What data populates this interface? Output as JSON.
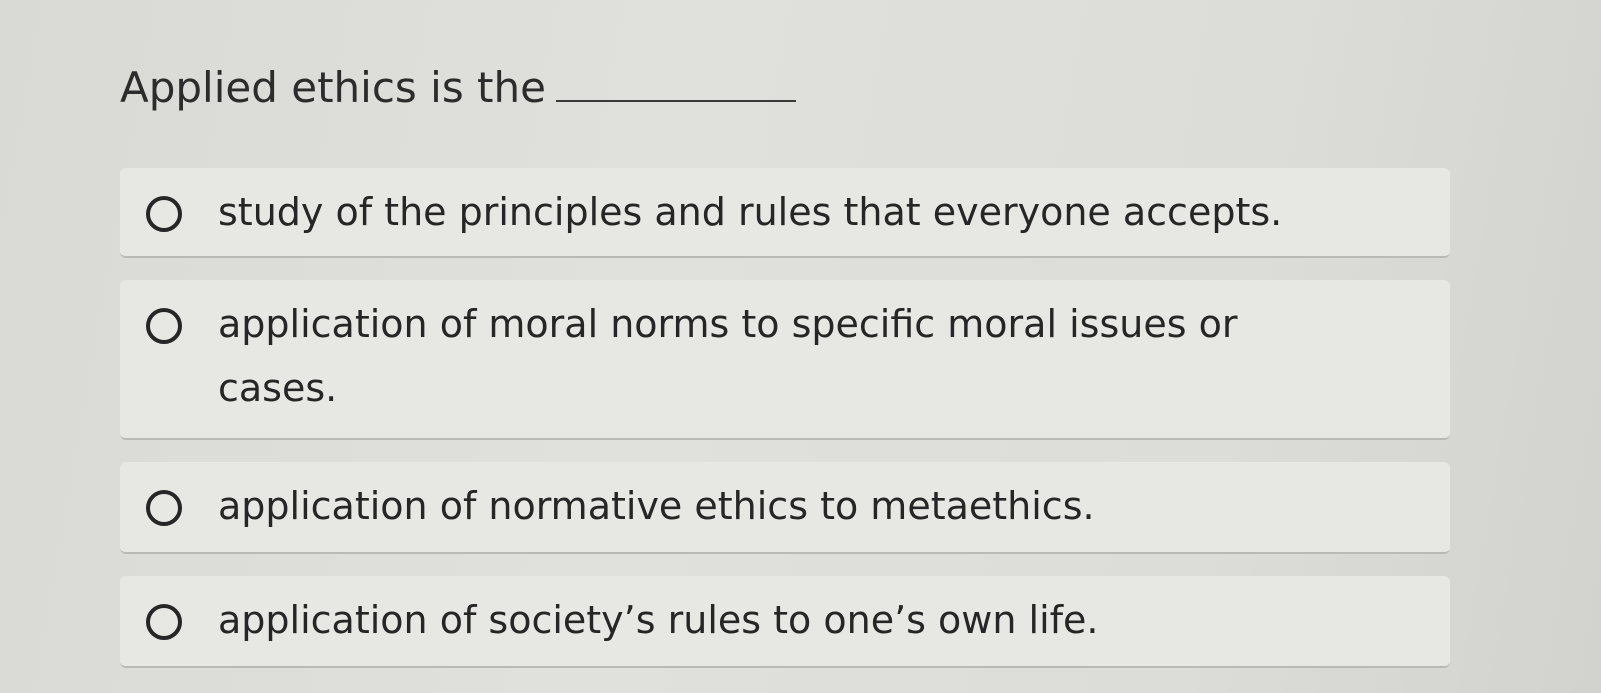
{
  "question": {
    "text": "Applied ethics is the"
  },
  "options": [
    {
      "label": "study of the principles and rules that everyone accepts."
    },
    {
      "label": "application of moral norms to specific moral issues or cases."
    },
    {
      "label": "application of normative ethics to metaethics."
    },
    {
      "label": "application of society’s rules to one’s own life."
    }
  ],
  "colors": {
    "background": "#dcdcd8",
    "option_background": "#e7e7e4",
    "text": "#262626"
  },
  "icons": {
    "radio": "radio-unchecked-icon"
  }
}
